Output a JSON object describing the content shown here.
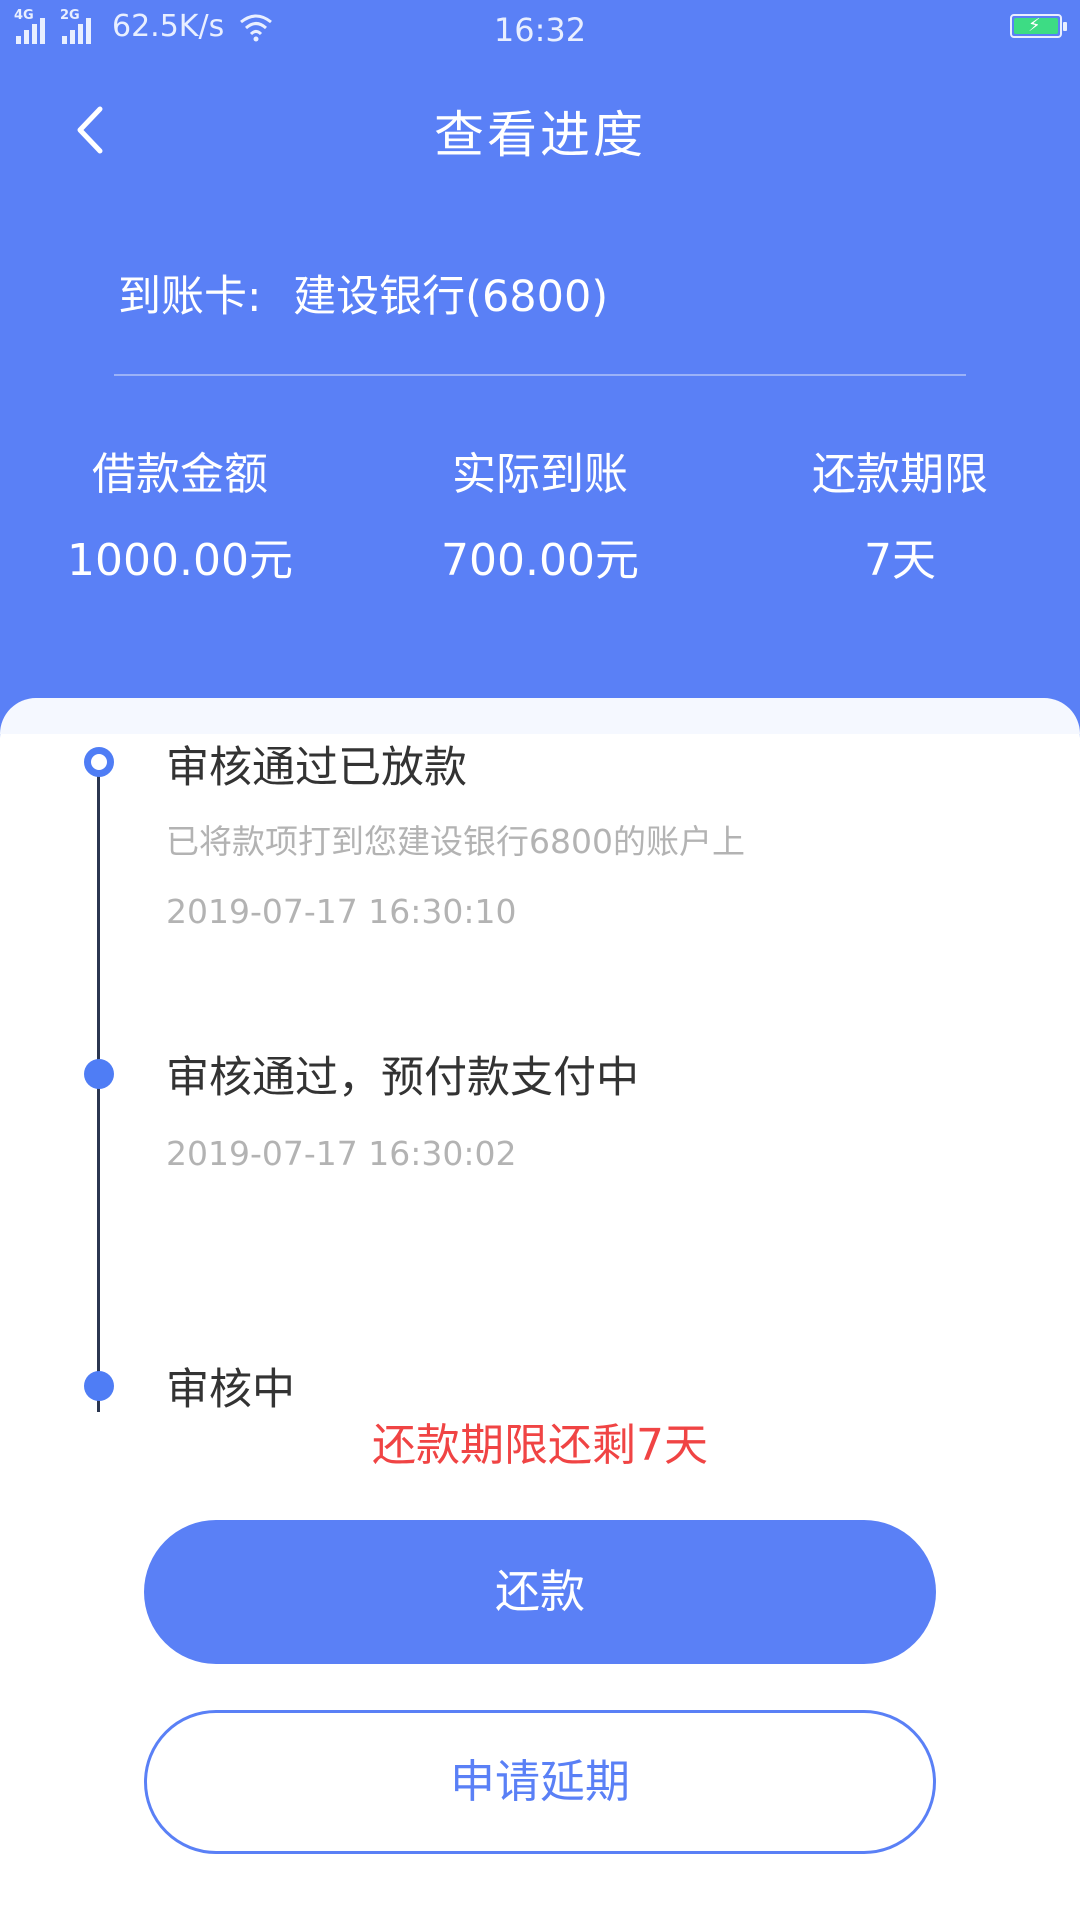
{
  "status_bar": {
    "network_1": "4G",
    "network_2": "2G",
    "speed": "62.5K/s",
    "time": "16:32",
    "battery_color": "#3ddc84"
  },
  "header": {
    "title": "查看进度",
    "back_icon": "chevron-left-icon"
  },
  "card": {
    "label": "到账卡:",
    "value": "建设银行(6800)"
  },
  "stats": [
    {
      "label": "借款金额",
      "value": "1000.00元"
    },
    {
      "label": "实际到账",
      "value": "700.00元"
    },
    {
      "label": "还款期限",
      "value": "7天"
    }
  ],
  "timeline": [
    {
      "title": "审核通过已放款",
      "desc": "已将款项打到您建设银行6800的账户上",
      "time": "2019-07-17 16:30:10"
    },
    {
      "title": "审核通过，预付款支付中",
      "time": "2019-07-17 16:30:02"
    },
    {
      "title": "审核中"
    }
  ],
  "remaining_text": "还款期限还剩7天",
  "buttons": {
    "repay": "还款",
    "extend": "申请延期"
  },
  "colors": {
    "primary": "#5a80f6",
    "warning": "#f04444"
  }
}
